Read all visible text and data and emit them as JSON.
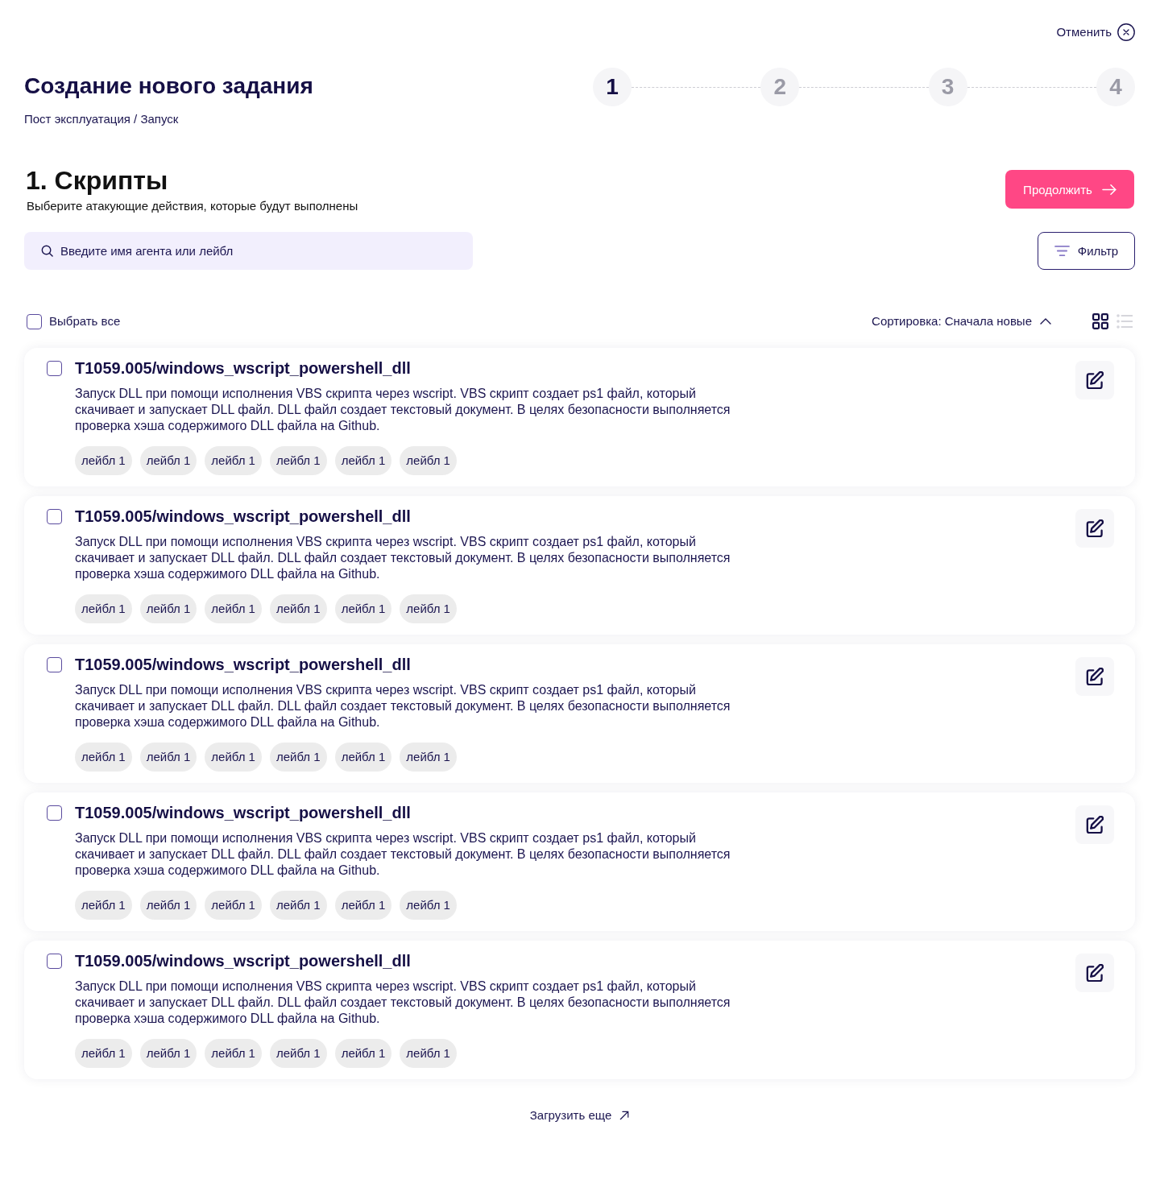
{
  "header": {
    "cancel_label": "Отменить",
    "title": "Создание нового задания",
    "breadcrumb": "Пост эксплуатация / Запуск"
  },
  "stepper": [
    {
      "label": "1",
      "selected": true
    },
    {
      "label": "2",
      "selected": false
    },
    {
      "label": "3",
      "selected": false
    },
    {
      "label": "4",
      "selected": false
    }
  ],
  "section": {
    "title": "1. Скрипты",
    "subtitle": "Выберите атакующие действия, которые будут выполнены",
    "continue_label": "Продолжить"
  },
  "search": {
    "placeholder": "Введите имя агента или лейбл"
  },
  "filter_button": {
    "label": "Фильтр"
  },
  "toolbar": {
    "select_all": {
      "label": "Выбрать все",
      "checked": false
    },
    "sort_label": "Сортировка: Сначала новые",
    "views": [
      {
        "kind": "grid",
        "selected": true
      },
      {
        "kind": "list",
        "selected": false
      }
    ]
  },
  "scripts": [
    {
      "title": "T1059.005/windows_wscript_powershell_dll",
      "checked": false,
      "description": "Запуск DLL при помощи исполнения VBS скрипта через wscript. VBS скрипт создает ps1 файл, который скачивает и запускает DLL файл. DLL файл создает текстовый документ. В целях безопасности выполняется проверка хэша содержимого DLL файла на Github.",
      "labels": [
        "лейбл 1",
        "лейбл 1",
        "лейбл 1",
        "лейбл 1",
        "лейбл 1",
        "лейбл 1"
      ]
    },
    {
      "title": "T1059.005/windows_wscript_powershell_dll",
      "checked": false,
      "description": "Запуск DLL при помощи исполнения VBS скрипта через wscript. VBS скрипт создает ps1 файл, который скачивает и запускает DLL файл. DLL файл создает текстовый документ. В целях безопасности выполняется проверка хэша содержимого DLL файла на Github.",
      "labels": [
        "лейбл 1",
        "лейбл 1",
        "лейбл 1",
        "лейбл 1",
        "лейбл 1",
        "лейбл 1"
      ]
    },
    {
      "title": "T1059.005/windows_wscript_powershell_dll",
      "checked": false,
      "description": "Запуск DLL при помощи исполнения VBS скрипта через wscript. VBS скрипт создает ps1 файл, который скачивает и запускает DLL файл. DLL файл создает текстовый документ. В целях безопасности выполняется проверка хэша содержимого DLL файла на Github.",
      "labels": [
        "лейбл 1",
        "лейбл 1",
        "лейбл 1",
        "лейбл 1",
        "лейбл 1",
        "лейбл 1"
      ]
    },
    {
      "title": "T1059.005/windows_wscript_powershell_dll",
      "checked": false,
      "description": "Запуск DLL при помощи исполнения VBS скрипта через wscript. VBS скрипт создает ps1 файл, который скачивает и запускает DLL файл. DLL файл создает текстовый документ. В целях безопасности выполняется проверка хэша содержимого DLL файла на Github.",
      "labels": [
        "лейбл 1",
        "лейбл 1",
        "лейбл 1",
        "лейбл 1",
        "лейбл 1",
        "лейбл 1"
      ]
    },
    {
      "title": "T1059.005/windows_wscript_powershell_dll",
      "checked": false,
      "description": "Запуск DLL при помощи исполнения VBS скрипта через wscript. VBS скрипт создает ps1 файл, который скачивает и запускает DLL файл. DLL файл создает текстовый документ. В целях безопасности выполняется проверка хэша содержимого DLL файла на Github.",
      "labels": [
        "лейбл 1",
        "лейбл 1",
        "лейбл 1",
        "лейбл 1",
        "лейбл 1",
        "лейбл 1"
      ]
    }
  ],
  "load_more": {
    "label": "Загрузить еще"
  }
}
